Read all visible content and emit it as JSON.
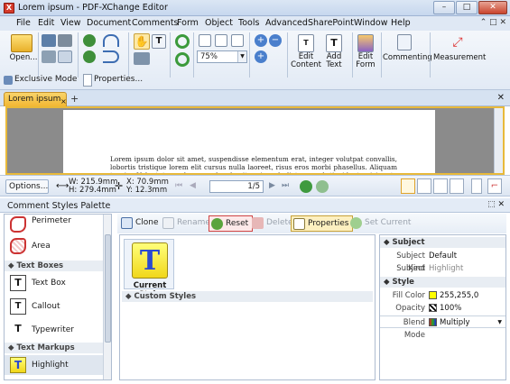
{
  "window": {
    "title": "Lorem ipsum - PDF-XChange Editor",
    "controls": {
      "minimize": "–",
      "maximize": "□",
      "close": "✕"
    }
  },
  "menu": {
    "items": [
      "File",
      "Edit",
      "View",
      "Document",
      "Comments",
      "Form",
      "Object",
      "Tools",
      "Advanced",
      "SharePoint",
      "Window",
      "Help"
    ],
    "help_controls": "⌃ □ ✕"
  },
  "toolbar": {
    "open_label": "Open...",
    "zoom_value": "75%",
    "edit_content_label": "Edit\nContent",
    "add_text_label": "Add\nText",
    "edit_form_label": "Edit\nForm",
    "commenting_label": "Commenting",
    "measurement_label": "Measurement",
    "exclusive_mode_label": "Exclusive Mode",
    "properties_label": "Properties..."
  },
  "tabs": {
    "doc_tab_label": "Lorem ipsum",
    "doc_tab_close": "×",
    "new_tab": "+",
    "close_all": "✕"
  },
  "document": {
    "text": "Lorem ipsum dolor sit amet, suspendisse elementum erat, integer volutpat convallis, lobortis tristique lorem elit cursus nulla laoreet, risus eros morbi phasellus. Aliquam turpis. Vulputate pede nunc hendrerit euismod dictum, vel tincidunt wisi ante ullamcorper. Praesent ullamcorper"
  },
  "statusbar": {
    "options_label": "Options...",
    "width": "W: 215.9mm",
    "height": "H: 279.4mm",
    "x": "X:   70.9mm",
    "y": "Y:   12.3mm",
    "page": "1/5"
  },
  "palette": {
    "title": "Comment Styles Palette",
    "controls": "⬚ ✕",
    "list": {
      "items": [
        {
          "label": "Perimeter",
          "icon": "perimeter-icon"
        },
        {
          "label": "Area",
          "icon": "area-icon"
        },
        {
          "label": "Text Box",
          "icon": "textbox-icon"
        },
        {
          "label": "Callout",
          "icon": "callout-icon"
        },
        {
          "label": "Typewriter",
          "icon": "typewriter-icon"
        },
        {
          "label": "Highlight",
          "icon": "highlight-icon"
        }
      ],
      "groups": [
        "Text Boxes",
        "Text Markups"
      ]
    },
    "buttons": {
      "clone": "Clone",
      "rename": "Rename",
      "reset": "Reset",
      "delete": "Delete",
      "properties": "Properties",
      "set_current": "Set Current"
    },
    "styles": {
      "current_style": "Current Style",
      "custom_styles": "Custom Styles",
      "tile_glyph": "T"
    },
    "properties": {
      "subject_header": "Subject",
      "subject_kind_key": "Subject Kind",
      "subject_kind_val": "Default",
      "subject_key": "Subject",
      "subject_val": "Highlight",
      "style_header": "Style",
      "fill_color_key": "Fill Color",
      "fill_color_val": "255,255,0",
      "opacity_key": "Opacity",
      "opacity_val": "100%",
      "blend_mode_key": "Blend Mode",
      "blend_mode_val": "Multiply"
    }
  },
  "colors": {
    "accent_tab": "#f2b733",
    "highlight_yellow": "#ffff00",
    "reset_red": "#d04444"
  }
}
